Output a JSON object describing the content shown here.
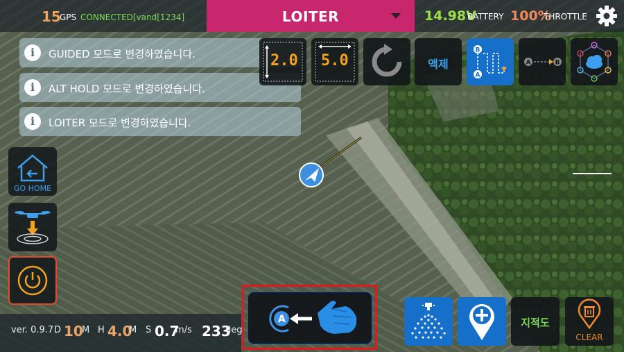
{
  "top_bar": {
    "gps_count": "15",
    "gps_label": "GPS",
    "connection": "CONNECTED[vand[1234]",
    "flight_mode": "LOITER",
    "battery_value": "14.98V",
    "battery_label": "BATTERY",
    "throttle_value": "100%",
    "throttle_label": "THROTTLE",
    "settings_icon": "gear-icon"
  },
  "notifications": [
    {
      "icon": "info-icon",
      "text": "GUIDED 모드로 변경하였습니다."
    },
    {
      "icon": "info-icon",
      "text": "ALT HOLD 모드로 변경하였습니다."
    },
    {
      "icon": "info-icon",
      "text": "LOITER 모드로 변경하였습니다."
    }
  ],
  "tools": {
    "height_value": "2.0",
    "width_value": "5.0",
    "refresh_icon": "refresh-icon",
    "liquid_label": "액제",
    "ab_mission_icon": "ab-route-icon",
    "ab_line_icon": "ab-line-icon",
    "cloud_network_icon": "cloud-network-icon"
  },
  "side_panel": {
    "go_home_label": "GO HOME",
    "land_icon": "drone-land-icon",
    "power_icon": "power-icon"
  },
  "status_bar": {
    "version": "ver. 0.9.7",
    "d_label": "D",
    "d_value": "10",
    "d_unit": "M",
    "h_label": "H",
    "h_value": "4.0",
    "h_unit": "M",
    "s_label": "S",
    "s_value": "0.7",
    "s_unit": "m/s",
    "heading_value": "233",
    "heading_unit": "deg"
  },
  "bottom_actions": {
    "ab_point_icon": "ab-point-hand-icon",
    "spray_icon": "spray-icon",
    "add_waypoint_icon": "add-waypoint-icon",
    "map_label": "지적도",
    "clear_label": "CLEAR"
  },
  "colors": {
    "mode_accent": "#c8266d",
    "highlight": "#e0191f",
    "tile_blue": "#1670c9"
  }
}
